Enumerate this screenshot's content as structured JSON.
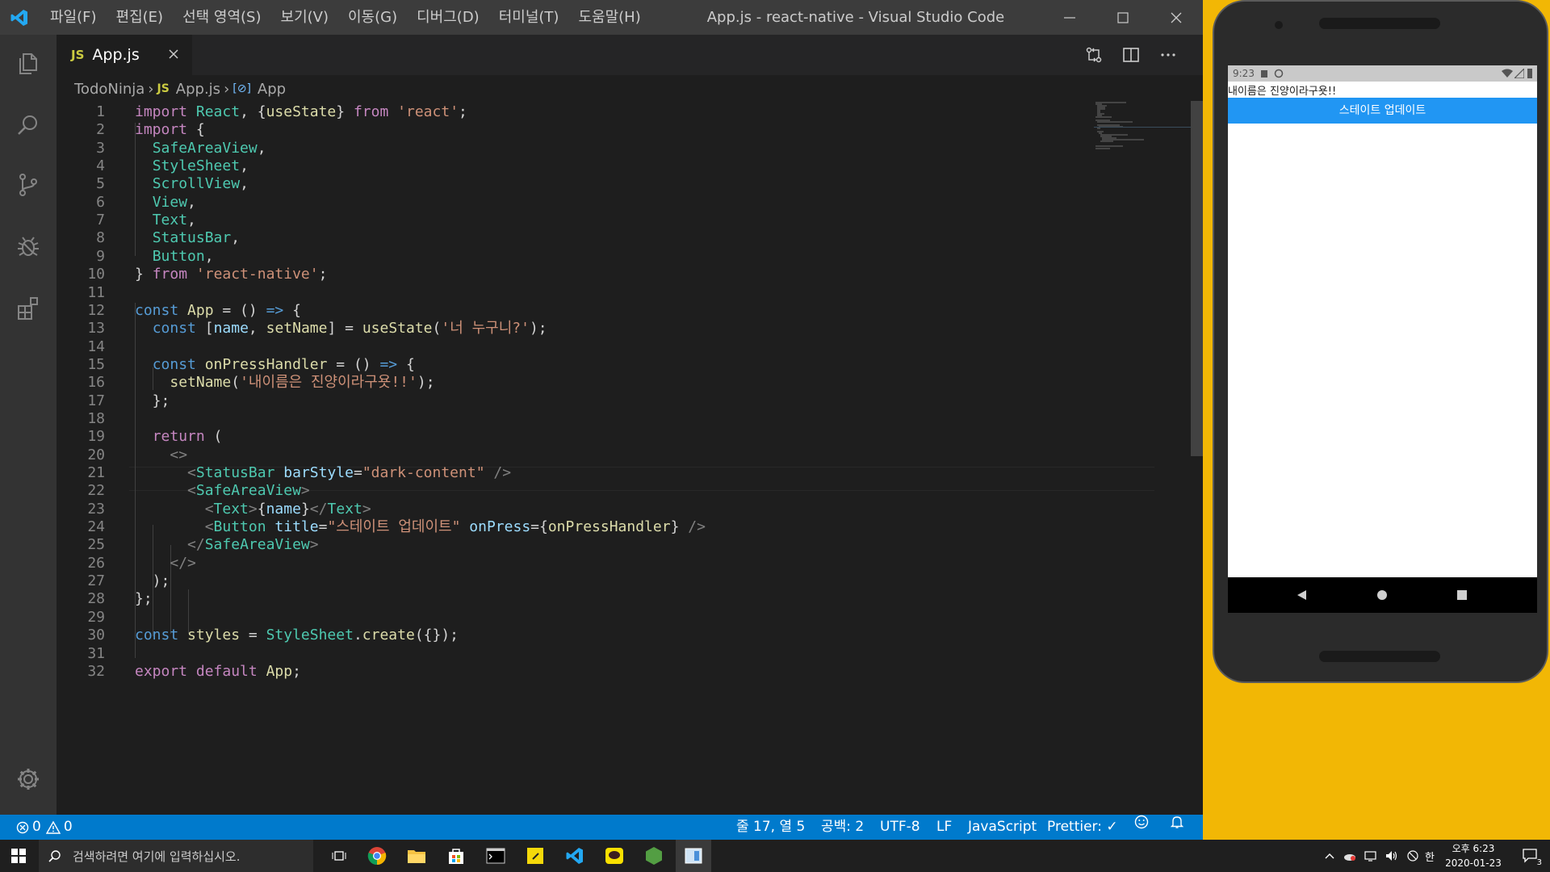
{
  "window": {
    "title": "App.js - react-native - Visual Studio Code",
    "menu": [
      "파일(F)",
      "편집(E)",
      "선택 영역(S)",
      "보기(V)",
      "이동(G)",
      "디버그(D)",
      "터미널(T)",
      "도움말(H)"
    ]
  },
  "tab": {
    "icon": "JS",
    "label": "App.js"
  },
  "breadcrumb": {
    "folder": "TodoNinja",
    "file_icon": "JS",
    "file": "App.js",
    "symbol": "App"
  },
  "editor": {
    "line_numbers": [
      "1",
      "2",
      "3",
      "4",
      "5",
      "6",
      "7",
      "8",
      "9",
      "10",
      "11",
      "12",
      "13",
      "14",
      "15",
      "16",
      "17",
      "18",
      "19",
      "20",
      "21",
      "22",
      "23",
      "24",
      "25",
      "26",
      "27",
      "28",
      "29",
      "30",
      "31",
      "32"
    ],
    "lines": [
      "import React, {useState} from 'react';",
      "import {",
      "  SafeAreaView,",
      "  StyleSheet,",
      "  ScrollView,",
      "  View,",
      "  Text,",
      "  StatusBar,",
      "  Button,",
      "} from 'react-native';",
      "",
      "const App = () => {",
      "  const [name, setName] = useState('너 누구니?');",
      "",
      "  const onPressHandler = () => {",
      "    setName('내이름은 진양이라구욧!!');",
      "  };",
      "",
      "  return (",
      "    <>",
      "      <StatusBar barStyle=\"dark-content\" />",
      "      <SafeAreaView>",
      "        <Text>{name}</Text>",
      "        <Button title=\"스테이트 업데이트\" onPress={onPressHandler} />",
      "      </SafeAreaView>",
      "    </>",
      "  );",
      "};",
      "",
      "const styles = StyleSheet.create({});",
      "",
      "export default App;"
    ]
  },
  "statusbar": {
    "errors": "0",
    "warnings": "0",
    "position": "줄 17, 열 5",
    "spaces": "공백: 2",
    "encoding": "UTF-8",
    "eol": "LF",
    "language": "JavaScript",
    "formatter": "Prettier: ✓"
  },
  "phone": {
    "status_time": "9:23",
    "app_text": "내이름은 진양이라구욧!!",
    "button_label": "스테이트 업데이트"
  },
  "taskbar": {
    "search_placeholder": "검색하려면 여기에 입력하십시오.",
    "clock_time": "오후 6:23",
    "clock_date": "2020-01-23",
    "notification_count": "3"
  },
  "colors": {
    "statusbar": "#007acc",
    "android_button": "#2196f3",
    "titlebar": "#3c3c3c",
    "editor_bg": "#1e1e1e"
  }
}
